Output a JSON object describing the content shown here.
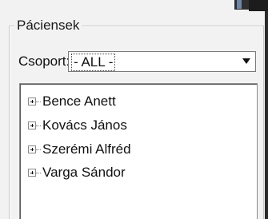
{
  "panel": {
    "title": "Páciensek"
  },
  "filter": {
    "label": "Csoport:",
    "selected": "- ALL -"
  },
  "tree": {
    "items": [
      {
        "label": "Bence Anett"
      },
      {
        "label": "Kovács János"
      },
      {
        "label": "Szerémi Alfréd"
      },
      {
        "label": "Varga Sándor"
      }
    ]
  }
}
